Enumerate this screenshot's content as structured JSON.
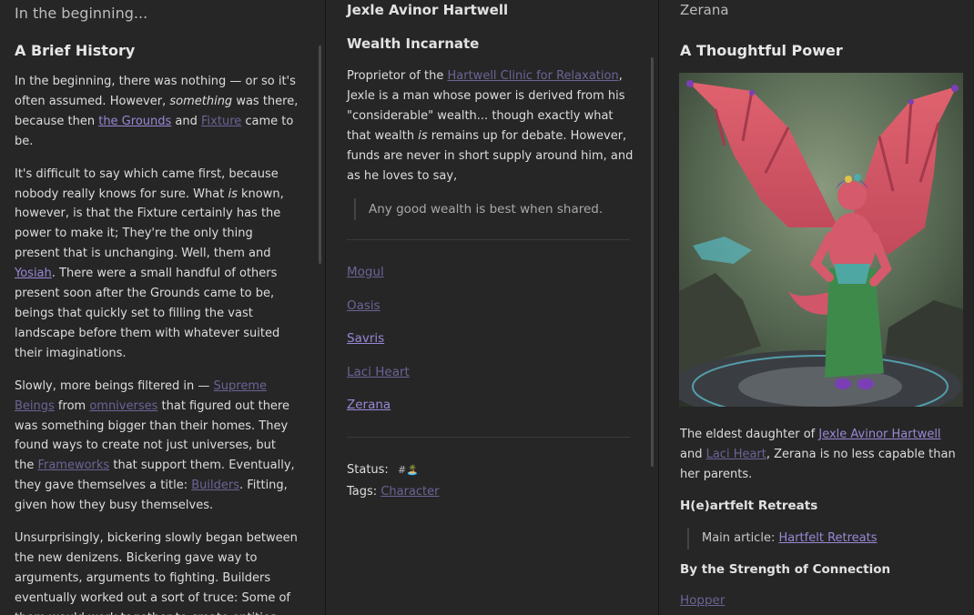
{
  "pane1": {
    "title": "In the beginning...",
    "heading": "A Brief History",
    "p1": {
      "t1": "In the beginning, there was nothing — or so it's often assumed. However, ",
      "em": "something",
      "t2": " was there, because then ",
      "link1": "the Grounds",
      "t3": " and ",
      "link2": "Fixture",
      "t4": " came to be."
    },
    "p2": {
      "t1": "It's difficult to say which came first, because nobody really knows for sure. What ",
      "em": "is",
      "t2": " known, however, is that the Fixture certainly has the power to make it; They're the only thing present that is unchanging. Well, them and ",
      "link1": "Yosiah",
      "t3": ". There were a small handful of others present soon after the Grounds came to be, beings that quickly set to filling the vast landscape before them with whatever suited their imaginations."
    },
    "p3": {
      "t1": "Slowly, more beings filtered in — ",
      "link1": "Supreme Beings",
      "t2": " from ",
      "link2": "omniverses",
      "t3": " that figured out there was something bigger than their homes. They found ways to create not just universes, but the ",
      "link3": "Frameworks",
      "t4": " that support them. Eventually, they gave themselves a title: ",
      "link4": "Builders",
      "t5": ". Fitting, given how they busy themselves."
    },
    "p4": {
      "t1": "Unsurprisingly, bickering slowly began between the new denizens. Bickering gave way to arguments, arguments to fighting. Builders eventually worked out a sort of truce: Some of them would work together to create entities,"
    }
  },
  "pane2": {
    "title": "Jexle Avinor Hartwell",
    "heading": "Wealth Incarnate",
    "p1": {
      "t1": "Proprietor of the ",
      "link1": "Hartwell Clinic for Relaxation",
      "t2": ", Jexle is a man whose power is derived from his \"considerable\" wealth... though exactly what that wealth ",
      "em": "is",
      "t3": " remains up for debate. However, funds are never in short supply around him, and as he loves to say,"
    },
    "quote": "Any good wealth is best when shared.",
    "links": [
      "Mogul",
      "Oasis",
      "Savris",
      "Laci Heart",
      "Zerana"
    ],
    "status_label": "Status:",
    "status_tag": "#🏝️",
    "tags_label": "Tags:",
    "tags_link": "Character"
  },
  "pane3": {
    "title": "Zerana",
    "heading": "A Thoughtful Power",
    "p1": {
      "t1": "The eldest daughter of ",
      "link1": "Jexle Avinor Hartwell",
      "t2": " and ",
      "link2": "Laci Heart",
      "t3": ", Zerana is no less capable than her parents."
    },
    "h3a": "H(e)artfelt Retreats",
    "quote_label": "Main article: ",
    "quote_link": "Hartfelt Retreats",
    "h3b": "By the Strength of Connection",
    "link_bottom": "Hopper"
  },
  "colors": {
    "link": "#9b87d6",
    "link_dim": "#6d6396",
    "background": "#262626"
  }
}
